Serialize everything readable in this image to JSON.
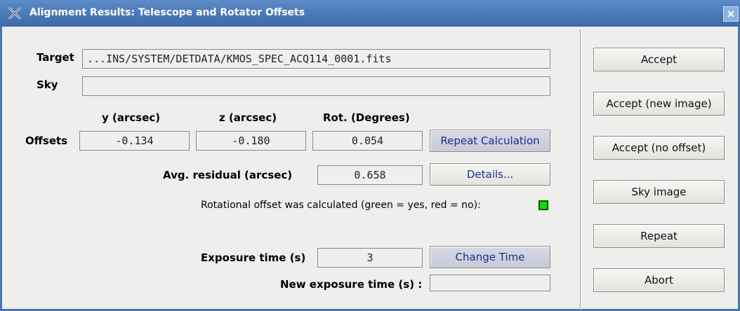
{
  "window": {
    "title": "Alignment Results: Telescope and Rotator Offsets",
    "close_glyph": "×"
  },
  "target": {
    "label": "Target",
    "value": "...INS/SYSTEM/DETDATA/KMOS_SPEC_ACQ114_0001.fits"
  },
  "sky": {
    "label": "Sky",
    "value": ""
  },
  "offsets": {
    "label": "Offsets",
    "col_y": "y (arcsec)",
    "col_z": "z (arcsec)",
    "col_rot": "Rot. (Degrees)",
    "y": "-0.134",
    "z": "-0.180",
    "rot": "0.054",
    "repeat_label": "Repeat Calculation"
  },
  "residual": {
    "label": "Avg. residual (arcsec)",
    "value": "0.658",
    "details_label": "Details..."
  },
  "rotation_status": {
    "text": "Rotational offset was calculated (green = yes, red = no):",
    "color": "#17d60f",
    "state": "yes"
  },
  "exposure": {
    "label": "Exposure time (s)",
    "value": "3",
    "change_label": "Change Time"
  },
  "new_exposure": {
    "label": "New exposure time (s) :",
    "value": ""
  },
  "actions": {
    "accept": "Accept",
    "accept_new": "Accept (new image)",
    "accept_no_offset": "Accept (no offset)",
    "sky_image": "Sky image",
    "repeat": "Repeat",
    "abort": "Abort"
  }
}
